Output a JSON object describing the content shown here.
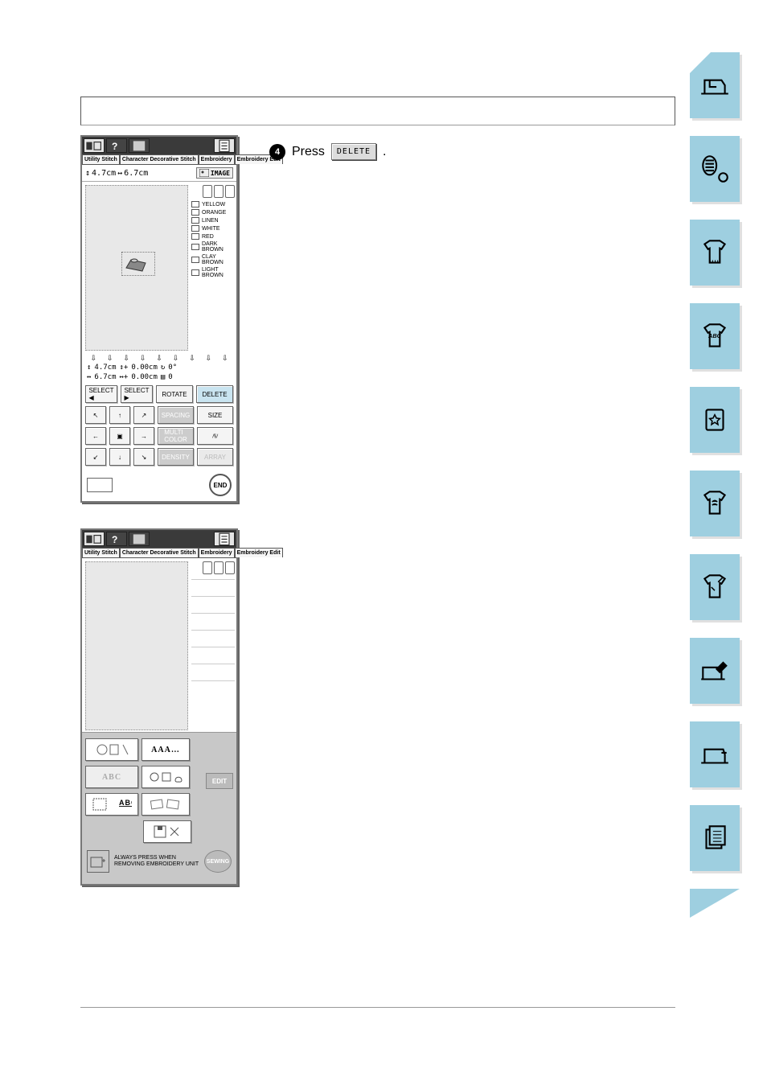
{
  "side_nav_count": 10,
  "instruction": {
    "step_number": "4",
    "prefix": "Press",
    "delete_label": "DELETE",
    "suffix": "."
  },
  "panel1": {
    "tabs": [
      "Utility\nStitch",
      "Character\nDecorative\nStitch",
      "Embroidery",
      "Embroidery\nEdit"
    ],
    "dim_h": "4.7cm",
    "dim_w": "6.7cm",
    "image_btn": "IMAGE",
    "threads": [
      "YELLOW",
      "ORANGE",
      "LINEN",
      "WHITE",
      "RED",
      "DARK\nBROWN",
      "CLAY\nBROWN",
      "LIGHT\nBROWN"
    ],
    "info": {
      "h": "4.7cm",
      "w": "6.7cm",
      "dx": "0.00cm",
      "dy": "0.00cm",
      "deg": "0°",
      "ord": "0"
    },
    "select_prev": "SELECT",
    "select_next": "SELECT",
    "rotate": "ROTATE",
    "delete": "DELETE",
    "size": "SIZE",
    "spacing": "SPACING",
    "multicolor": "MULTI\nCOLOR",
    "density": "DENSITY",
    "array": "ARRAY",
    "end": "END"
  },
  "panel2": {
    "tabs": [
      "Utility\nStitch",
      "Character\nDecorative\nStitch",
      "Embroidery",
      "Embroidery\nEdit"
    ],
    "cat_emb": "",
    "cat_font": "AAA",
    "cat_abc": "ABC",
    "cat_shapes": "",
    "cat_frame": "ABC",
    "cat_cards": "",
    "cat_save": "",
    "edit": "EDIT",
    "foot_text": "ALWAYS PRESS WHEN REMOVING EMBROIDERY UNIT",
    "sewing": "SEWING"
  }
}
